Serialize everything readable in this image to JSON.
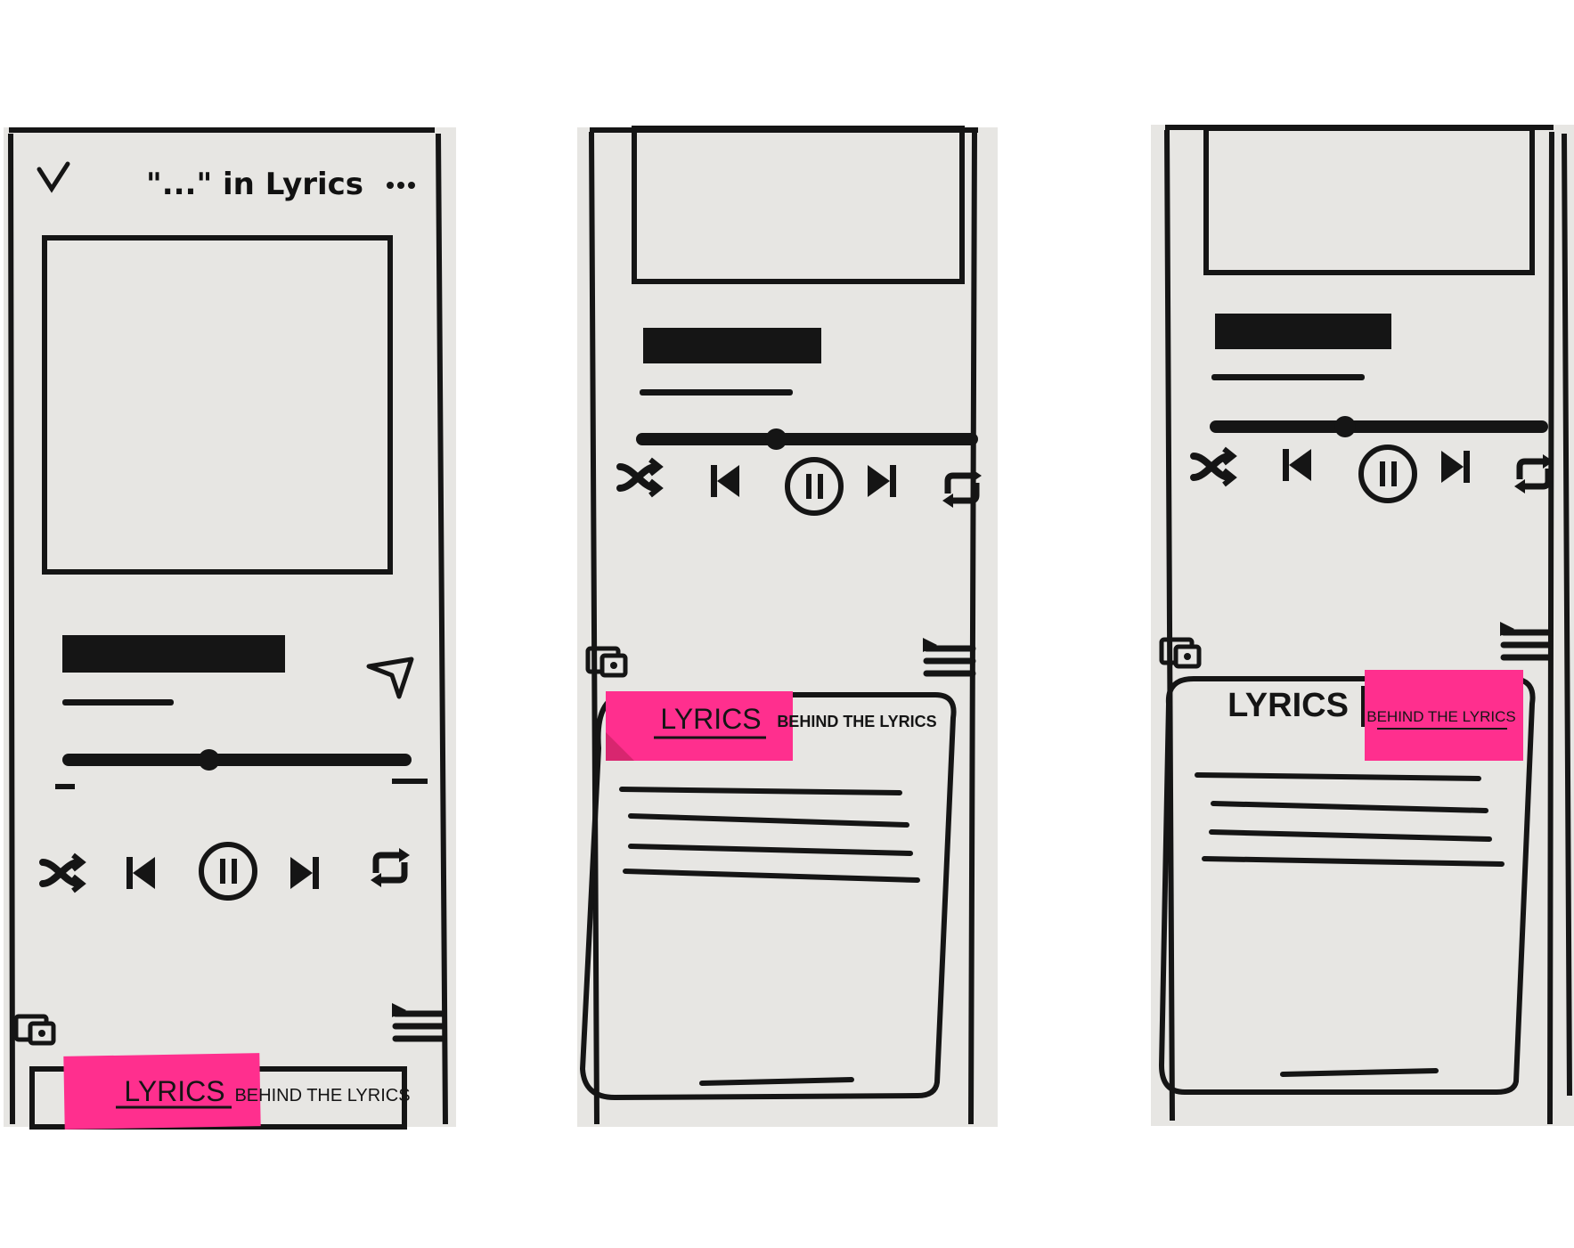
{
  "colors": {
    "paper": "#e7e6e3",
    "ink": "#151515",
    "sticky_note": "#ff2f8e",
    "background": "#ffffff"
  },
  "screen1": {
    "header": {
      "collapse_icon": "chevron-down-icon",
      "title": "\"...\" in Lyrics",
      "more_icon": "more-icon"
    },
    "progress": 0.42,
    "controls": [
      "shuffle-icon",
      "previous-icon",
      "pause-icon",
      "next-icon",
      "repeat-icon"
    ],
    "share_icon": "send-icon",
    "bottom_icons": [
      "devices-icon",
      "queue-icon"
    ],
    "tabs": {
      "active": "LYRICS",
      "inactive": "BEHIND THE LYRICS"
    }
  },
  "screen2": {
    "progress": 0.41,
    "controls": [
      "shuffle-icon",
      "previous-icon",
      "pause-icon",
      "next-icon",
      "repeat-icon"
    ],
    "bottom_icons": [
      "devices-icon",
      "queue-icon"
    ],
    "tabs": {
      "active": "LYRICS",
      "inactive": "BEHIND THE LYRICS"
    }
  },
  "screen3": {
    "progress": 0.4,
    "controls": [
      "shuffle-icon",
      "previous-icon",
      "pause-icon",
      "next-icon",
      "repeat-icon"
    ],
    "bottom_icons": [
      "devices-icon",
      "queue-icon"
    ],
    "tabs": {
      "inactive": "LYRICS",
      "active": "BEHIND THE LYRICS"
    }
  }
}
